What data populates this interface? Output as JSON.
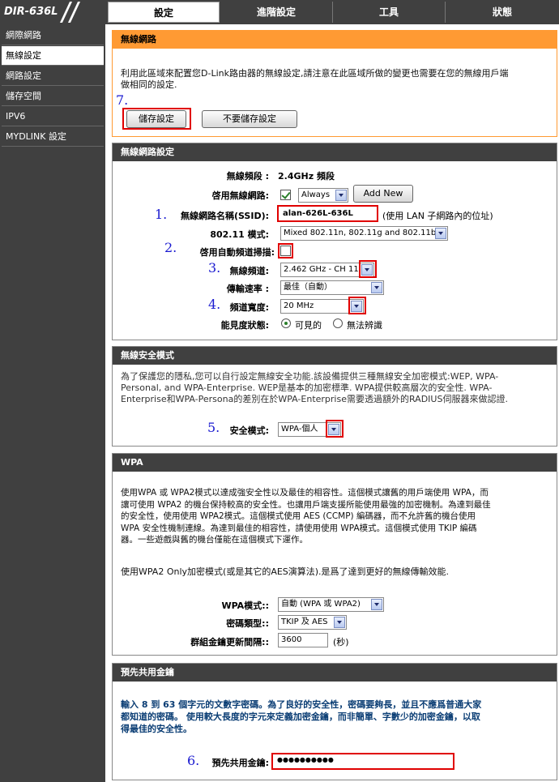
{
  "header": {
    "logo": "DIR-636L",
    "tabs": [
      "設定",
      "進階設定",
      "工具",
      "狀態"
    ],
    "active_tab": "設定"
  },
  "sidebar": {
    "items": [
      "網際網路",
      "無線設定",
      "網路設定",
      "儲存空間",
      "IPV6",
      "MYDLINK 設定"
    ],
    "active": "無線設定"
  },
  "wireless_network": {
    "title": "無線網路",
    "description_line1": "利用此區域來配置您D-Link路由器的無線設定,請注意在此區域所做的變更也需要在您的無線用戶端",
    "description_line2": "做相同的設定.",
    "step": "7.",
    "save_label": "儲存設定",
    "dont_save_label": "不要儲存設定"
  },
  "wireless_settings": {
    "title": "無線網路設定",
    "band_label": "無線頻段 :",
    "band_value": "2.4GHz 頻段",
    "enable_label": "啓用無線網路:",
    "enable_checked": true,
    "schedule_value": "Always",
    "add_new_label": "Add New",
    "ssid_step": "1.",
    "ssid_label": "無線網路名稱(SSID):",
    "ssid_value": "alan-626L-636L",
    "ssid_note": "(使用 LAN 子網路內的位址)",
    "mode_label": "802.11 模式:",
    "mode_value": "Mixed 802.11n, 802.11g and 802.11b",
    "auto_channel_step": "2.",
    "auto_channel_label": "啓用自動頻道掃描:",
    "auto_channel_checked": false,
    "channel_step": "3.",
    "channel_label": "無線頻道:",
    "channel_value": "2.462 GHz - CH 11",
    "rate_label": "傳輸速率 :",
    "rate_value": "最佳（自動）",
    "width_step": "4.",
    "width_label": "頻道寬度:",
    "width_value": "20 MHz",
    "visibility_label": "能見度狀態:",
    "visible_label": "可見的",
    "invisible_label": "無法辨識",
    "visible_selected": true
  },
  "security_mode": {
    "title": "無線安全模式",
    "desc_line1": "為了保護您的隱私,您可以自行設定無線安全功能.該設備提供三種無線安全加密模式:WEP, WPA-",
    "desc_line2": "Personal, and WPA-Enterprise. WEP是基本的加密標準. WPA提供較高層次的安全性. WPA-",
    "desc_line3": "Enterprise和WPA-Persona的差別在於WPA-Enterprise需要透過額外的RADIUS伺服器來做認證.",
    "step": "5.",
    "mode_label": "安全模式:",
    "mode_value": "WPA-個人"
  },
  "wpa": {
    "title": "WPA",
    "p1_line1": "使用WPA 或 WPA2模式以達成強安全性以及最佳的相容性。這個模式讓舊的用戶端使用 WPA，而",
    "p1_line2": "讓可使用 WPA2 的機台保持較高的安全性。也讓用戶端支援所能使用最強的加密機制。為達到最佳",
    "p1_line3": "的安全性，使用使用 WPA2模式。這個模式使用 AES (CCMP) 編碼器，而不允許舊的機台使用",
    "p1_line4": "WPA 安全性機制連線。為達到最佳的相容性，請使用使用 WPA模式。這個模式使用 TKIP 編碼",
    "p1_line5": "器。一些遊戲與舊的機台僅能在這個模式下運作。",
    "p2": "使用WPA2 Only加密模式(或是其它的AES演算法).是爲了達到更好的無線傳輸效能.",
    "wpa_mode_label": "WPA模式::",
    "wpa_mode_value": "自動 (WPA 或 WPA2)",
    "cipher_label": "密碼類型::",
    "cipher_value": "TKIP 及 AES",
    "rekey_label": "群組金鑰更新間隔::",
    "rekey_value": "3600",
    "rekey_unit": "(秒)"
  },
  "psk": {
    "title": "預先共用金鑰",
    "desc_line1": "輸入 8 到 63 個字元的文數字密碼。為了良好的安全性，密碼要夠長，並且不應爲普通大家",
    "desc_line2": "都知道的密碼。 使用較大長度的字元來定義加密金鑰，而非簡單、字數少的加密金鑰，以取",
    "desc_line3": "得最佳的安全性。",
    "step": "6.",
    "key_label": "預先共用金鑰:",
    "key_value": "●●●●●●●●●●"
  },
  "colors": {
    "accent_orange": "#ff9a33",
    "header_dark": "#404040",
    "highlight_red": "#e00000",
    "step_blue": "#1a1ad0"
  }
}
